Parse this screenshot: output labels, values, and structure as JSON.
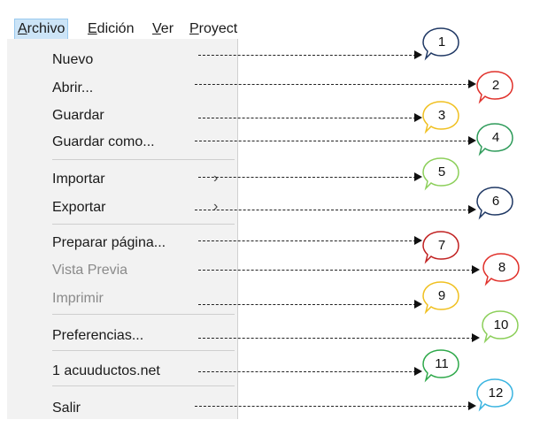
{
  "menubar": {
    "items": [
      {
        "pre": "",
        "ul": "A",
        "post": "rchivo"
      },
      {
        "pre": "",
        "ul": "E",
        "post": "dición"
      },
      {
        "pre": "",
        "ul": "V",
        "post": "er"
      },
      {
        "pre": "",
        "ul": "P",
        "post": "royect"
      }
    ]
  },
  "menu": {
    "items": [
      {
        "label": "Nuevo",
        "enabled": true,
        "submenu": false
      },
      {
        "label": "Abrir...",
        "enabled": true,
        "submenu": false
      },
      {
        "label": "Guardar",
        "enabled": true,
        "submenu": false
      },
      {
        "label": "Guardar como...",
        "enabled": true,
        "submenu": false
      },
      {
        "label": "Importar",
        "enabled": true,
        "submenu": true
      },
      {
        "label": "Exportar",
        "enabled": true,
        "submenu": true
      },
      {
        "label": "Preparar página...",
        "enabled": true,
        "submenu": false
      },
      {
        "label": "Vista Previa",
        "enabled": false,
        "submenu": false
      },
      {
        "label": "Imprimir",
        "enabled": false,
        "submenu": false
      },
      {
        "label": "Preferencias...",
        "enabled": true,
        "submenu": false
      },
      {
        "label": "1 acuuductos.net",
        "enabled": true,
        "submenu": false
      },
      {
        "label": "Salir",
        "enabled": true,
        "submenu": false
      }
    ],
    "chevron": "›"
  },
  "callouts": [
    {
      "number": "1",
      "color": "#1f3864"
    },
    {
      "number": "2",
      "color": "#e0302a"
    },
    {
      "number": "3",
      "color": "#f0c020"
    },
    {
      "number": "4",
      "color": "#2e9b5a"
    },
    {
      "number": "5",
      "color": "#8ccf5a"
    },
    {
      "number": "6",
      "color": "#1f3864"
    },
    {
      "number": "7",
      "color": "#c02020"
    },
    {
      "number": "8",
      "color": "#e0302a"
    },
    {
      "number": "9",
      "color": "#f0c020"
    },
    {
      "number": "10",
      "color": "#8ccf5a"
    },
    {
      "number": "11",
      "color": "#2ea84a"
    },
    {
      "number": "12",
      "color": "#3ab4e0"
    }
  ]
}
